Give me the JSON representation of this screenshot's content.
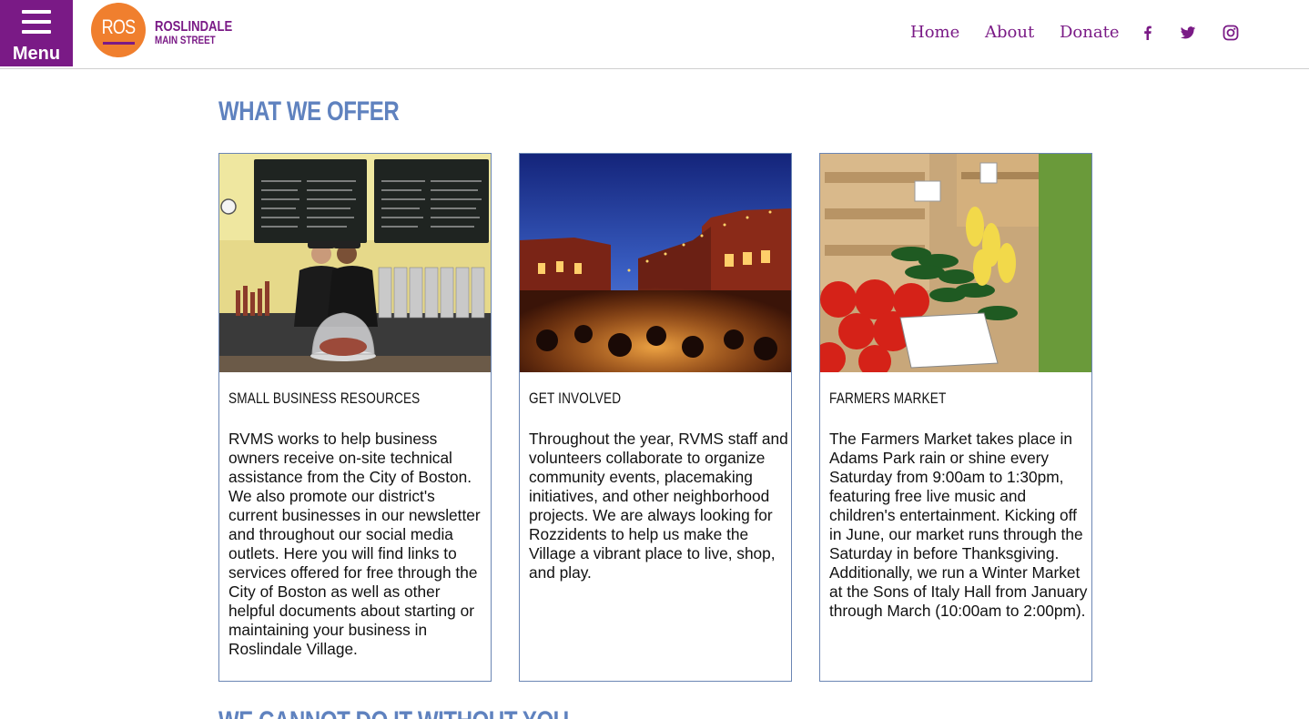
{
  "header": {
    "menu_label": "Menu",
    "logo": {
      "abbr": "ROS",
      "line1": "ROSLINDALE",
      "line2": "MAIN STREET",
      "circle_color": "#f07f2e"
    },
    "nav": [
      {
        "label": "Home"
      },
      {
        "label": "About"
      },
      {
        "label": "Donate"
      }
    ],
    "social_icons": [
      "facebook-icon",
      "twitter-icon",
      "instagram-icon"
    ],
    "brand_color": "#7a1a86"
  },
  "main": {
    "section_title": "WHAT WE OFFER",
    "cards": [
      {
        "title": "SMALL BUSINESS RESOURCES",
        "body": "RVMS works to help business owners receive on-site technical assistance from the City of Boston. We also promote our district's current businesses in our newsletter and throughout our social media outlets. Here you will find links to services offered for free through the City of Boston as well as other helpful documents about starting or maintaining your business in Roslindale Village."
      },
      {
        "title": "GET INVOLVED",
        "body": "Throughout the year, RVMS staff and volunteers collaborate to organize community events, placemaking initiatives, and other neighborhood projects. We are always looking for Rozzidents to help us make the Village a vibrant place to live, shop, and play."
      },
      {
        "title": "FARMERS MARKET",
        "body": "The Farmers Market takes place in Adams Park rain or shine every Saturday from 9:00am to 1:30pm, featuring free live music and children's entertainment. Kicking off in June, our market runs through the Saturday in before Thanksgiving. Additionally, we run a Winter Market at the Sons of Italy Hall from January through March (10:00am to 2:00pm)."
      }
    ],
    "section_title_2": "WE CANNOT DO IT WITHOUT YOU",
    "accent_color": "#5f82bf"
  }
}
